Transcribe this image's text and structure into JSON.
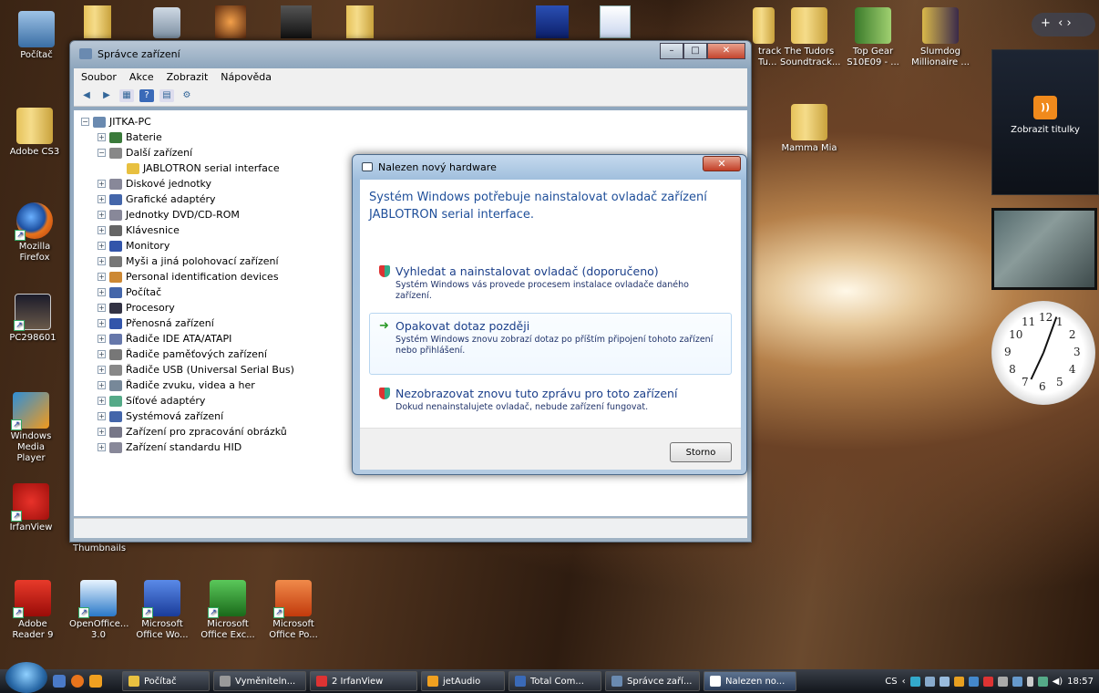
{
  "desktop": {
    "icons_left": [
      {
        "label": "Počítač"
      },
      {
        "label": "Adobe CS3"
      },
      {
        "label": "Mozilla Firefox"
      },
      {
        "label": "PC298601"
      },
      {
        "label": "Windows Media Player"
      },
      {
        "label": "IrfanView"
      }
    ],
    "icons_bottom": [
      {
        "label": "Adobe Reader 9"
      },
      {
        "label": "OpenOffice... 3.0"
      },
      {
        "label": "Microsoft Office Wo..."
      },
      {
        "label": "Microsoft Office Exc..."
      },
      {
        "label": "Microsoft Office Po..."
      }
    ],
    "icons_right": [
      {
        "label": "track Tu..."
      },
      {
        "label": "The Tudors Soundtrack..."
      },
      {
        "label": "Top Gear S10E09 - ..."
      },
      {
        "label": "Slumdog Millionaire ..."
      },
      {
        "label": "Mamma Mia"
      }
    ],
    "thumbnails_label": "Thumbnails"
  },
  "device_manager": {
    "title": "Správce zařízení",
    "menu": [
      "Soubor",
      "Akce",
      "Zobrazit",
      "Nápověda"
    ],
    "root": "JITKA-PC",
    "nodes": [
      {
        "label": "Baterie"
      },
      {
        "label": "Další zařízení",
        "expanded": true,
        "children": [
          "JABLOTRON serial interface"
        ]
      },
      {
        "label": "Diskové jednotky"
      },
      {
        "label": "Grafické adaptéry"
      },
      {
        "label": "Jednotky DVD/CD-ROM"
      },
      {
        "label": "Klávesnice"
      },
      {
        "label": "Monitory"
      },
      {
        "label": "Myši a jiná polohovací zařízení"
      },
      {
        "label": "Personal identification devices"
      },
      {
        "label": "Počítač"
      },
      {
        "label": "Procesory"
      },
      {
        "label": "Přenosná zařízení"
      },
      {
        "label": "Řadiče IDE ATA/ATAPI"
      },
      {
        "label": "Řadiče paměťových zařízení"
      },
      {
        "label": "Řadiče USB (Universal Serial Bus)"
      },
      {
        "label": "Řadiče zvuku, videa a her"
      },
      {
        "label": "Síťové adaptéry"
      },
      {
        "label": "Systémová zařízení"
      },
      {
        "label": "Zařízení pro zpracování obrázků"
      },
      {
        "label": "Zařízení standardu HID"
      }
    ]
  },
  "dialog": {
    "title": "Nalezen nový hardware",
    "heading": "Systém Windows potřebuje nainstalovat ovladač zařízení JABLOTRON serial interface.",
    "options": [
      {
        "title": "Vyhledat a nainstalovat ovladač (doporučeno)",
        "desc": "Systém Windows vás provede procesem instalace ovladače daného zařízení."
      },
      {
        "title": "Opakovat dotaz později",
        "desc": "Systém Windows znovu zobrazí dotaz po příštím připojení tohoto zařízení nebo přihlášení."
      },
      {
        "title": "Nezobrazovat znovu tuto zprávu pro toto zařízení",
        "desc": "Dokud nenainstalujete ovladač, nebude zařízení fungovat."
      }
    ],
    "cancel": "Storno"
  },
  "sidebar": {
    "rss_label": "Zobrazit titulky",
    "clock_numbers": [
      "12",
      "1",
      "2",
      "3",
      "4",
      "5",
      "6",
      "7",
      "8",
      "9",
      "10",
      "11"
    ]
  },
  "taskbar": {
    "tasks": [
      "Počítač",
      "Vyměniteln...",
      "2 IrfanView",
      "jetAudio",
      "Total Com...",
      "Správce zaří...",
      "Nalezen no..."
    ],
    "lang": "CS",
    "time": "18:57"
  }
}
